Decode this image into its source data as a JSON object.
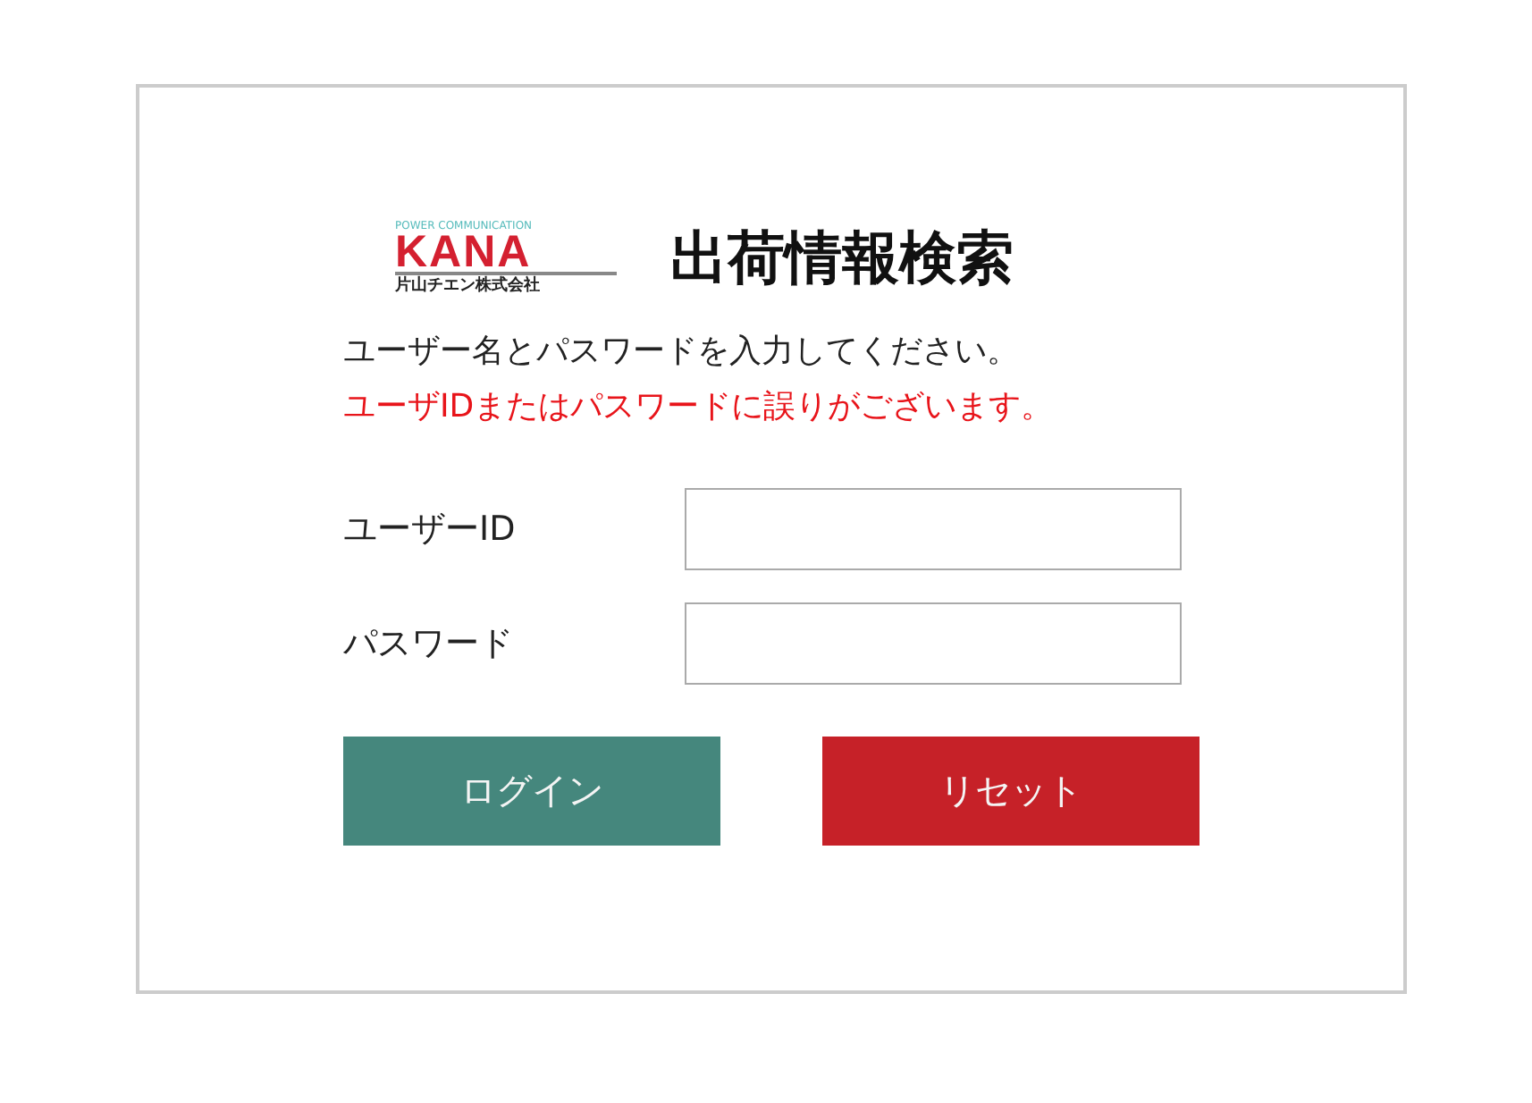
{
  "logo": {
    "tagline": "POWER COMMUNICATION",
    "brand": "KANA",
    "company": "片山チエン株式会社"
  },
  "title": "出荷情報検索",
  "instruction": "ユーザー名とパスワードを入力してください。",
  "error": "ユーザIDまたはパスワードに誤りがございます。",
  "fields": [
    {
      "label": "ユーザーID"
    },
    {
      "label": "パスワード"
    }
  ],
  "buttons": [
    {
      "label": "ログイン",
      "kind": "primary"
    },
    {
      "label": "リセット",
      "kind": "danger"
    }
  ]
}
